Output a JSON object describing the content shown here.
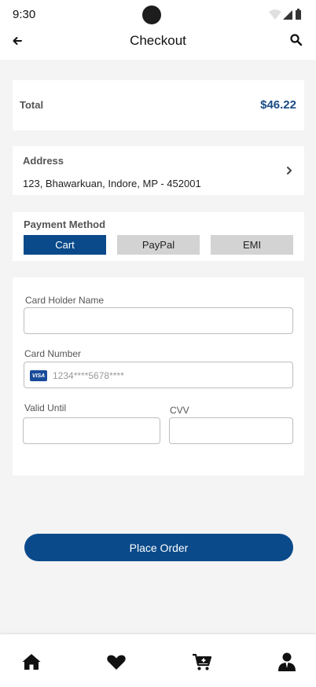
{
  "status_bar": {
    "time": "9:30"
  },
  "app_bar": {
    "title": "Checkout"
  },
  "total": {
    "label": "Total",
    "value": "$46.22"
  },
  "address": {
    "label": "Address",
    "text": "123, Bhawarkuan, Indore, MP - 452001"
  },
  "payment": {
    "label": "Payment Method",
    "methods": [
      {
        "label": "Cart",
        "selected": true
      },
      {
        "label": "PayPal",
        "selected": false
      },
      {
        "label": "EMI",
        "selected": false
      }
    ]
  },
  "form": {
    "card_holder_label": "Card Holder Name",
    "card_holder_value": "",
    "card_number_label": "Card Number",
    "card_brand": "VISA",
    "card_number_value": "1234****5678****",
    "valid_until_label": "Valid Until",
    "valid_until_value": "",
    "cvv_label": "CVV",
    "cvv_value": ""
  },
  "actions": {
    "place_order": "Place Order"
  },
  "bottom_nav": [
    "home-icon",
    "heart-icon",
    "cart-add-icon",
    "profile-icon"
  ],
  "colors": {
    "primary": "#0a4a8a",
    "total": "#1a4b85",
    "inactive_tab": "#d3d3d3",
    "background": "#f4f4f4"
  }
}
